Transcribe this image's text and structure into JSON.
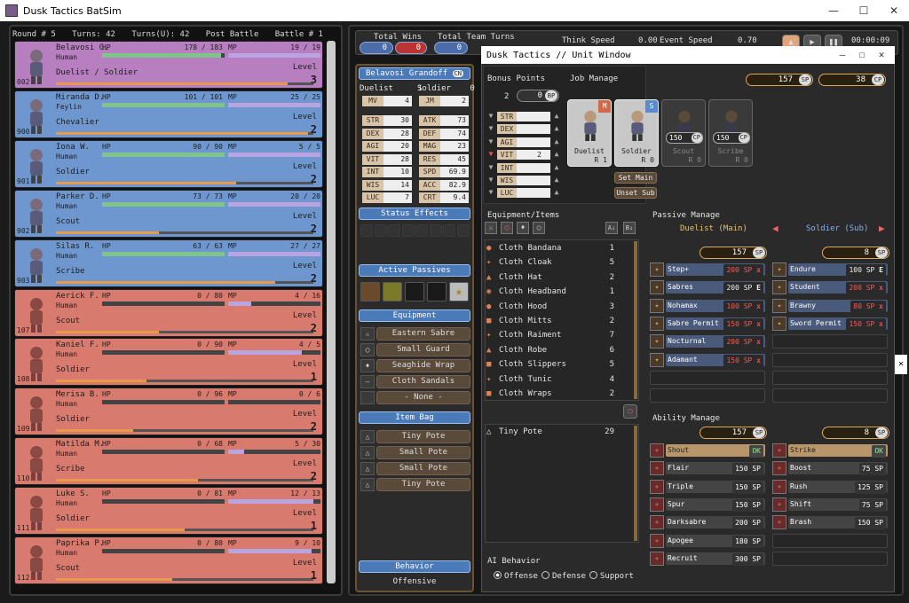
{
  "app": {
    "title": "Dusk Tactics BatSim"
  },
  "header": {
    "round": "Round # 5",
    "turns": "Turns: 42",
    "turnsu": "Turns(U): 42",
    "phase": "Post Battle",
    "battle": "Battle # 1"
  },
  "units": [
    {
      "id": "002",
      "name": "Belavosi G.",
      "race": "Human",
      "job": "Duelist / Soldier",
      "hp": "178 / 183",
      "mp": "19 / 19",
      "level": "3",
      "color": "#b77fc0",
      "hp_frac": 0.97,
      "mp_frac": 1.0,
      "xp_frac": 0.9
    },
    {
      "id": "900",
      "name": "Miranda D.",
      "race": "Feylin",
      "job": "Chevalier",
      "hp": "101 / 101",
      "mp": "25 / 25",
      "level": "2",
      "color": "#6f97cf",
      "hp_frac": 1.0,
      "mp_frac": 1.0,
      "xp_frac": 0.98
    },
    {
      "id": "901",
      "name": "Iona W.",
      "race": "Human",
      "job": "Soldier",
      "hp": "90 / 90",
      "mp": "5 / 5",
      "level": "2",
      "color": "#6f97cf",
      "hp_frac": 1.0,
      "mp_frac": 1.0,
      "xp_frac": 0.7
    },
    {
      "id": "902",
      "name": "Parker D.",
      "race": "Human",
      "job": "Scout",
      "hp": "73 / 73",
      "mp": "20 / 20",
      "level": "2",
      "color": "#6f97cf",
      "hp_frac": 1.0,
      "mp_frac": 1.0,
      "xp_frac": 0.4
    },
    {
      "id": "903",
      "name": "Silas R.",
      "race": "Human",
      "job": "Scribe",
      "hp": "63 / 63",
      "mp": "27 / 27",
      "level": "2",
      "color": "#6f97cf",
      "hp_frac": 1.0,
      "mp_frac": 1.0,
      "xp_frac": 0.85
    },
    {
      "id": "107",
      "name": "Aerick F.",
      "race": "Human",
      "job": "Scout",
      "hp": "0 / 80",
      "mp": "4 / 16",
      "level": "2",
      "color": "#d97a6e",
      "hp_frac": 0,
      "mp_frac": 0.25,
      "xp_frac": 0.4
    },
    {
      "id": "108",
      "name": "Kaniel F.",
      "race": "Human",
      "job": "Soldier",
      "hp": "0 / 90",
      "mp": "4 / 5",
      "level": "1",
      "color": "#d97a6e",
      "hp_frac": 0,
      "mp_frac": 0.8,
      "xp_frac": 0.35
    },
    {
      "id": "109",
      "name": "Merisa B.",
      "race": "Human",
      "job": "Soldier",
      "hp": "0 / 96",
      "mp": "0 / 6",
      "level": "2",
      "color": "#d97a6e",
      "hp_frac": 0,
      "mp_frac": 0,
      "xp_frac": 0.3
    },
    {
      "id": "110",
      "name": "Matilda M.",
      "race": "Human",
      "job": "Scribe",
      "hp": "0 / 68",
      "mp": "5 / 30",
      "level": "2",
      "color": "#d97a6e",
      "hp_frac": 0,
      "mp_frac": 0.17,
      "xp_frac": 0.55
    },
    {
      "id": "111",
      "name": "Luke S.",
      "race": "Human",
      "job": "Soldier",
      "hp": "0 / 81",
      "mp": "12 / 13",
      "level": "1",
      "color": "#d97a6e",
      "hp_frac": 0,
      "mp_frac": 0.92,
      "xp_frac": 0.5
    },
    {
      "id": "112",
      "name": "Paprika P.",
      "race": "Human",
      "job": "Scout",
      "hp": "0 / 80",
      "mp": "9 / 10",
      "level": "1",
      "color": "#d97a6e",
      "hp_frac": 0,
      "mp_frac": 0.9,
      "xp_frac": 0.45
    }
  ],
  "labels": {
    "hp": "HP",
    "mp": "MP",
    "level": "Level"
  },
  "topbar": {
    "total_wins": "Total Wins",
    "wins_a": "0",
    "wins_b": "0",
    "total_team_turns": "Total Team Turns",
    "tt_a": "0",
    "tt_b": "0",
    "think_speed": "Think Speed",
    "think_val": "0.00",
    "event_speed": "Event Speed",
    "event_val": "0.70",
    "timer": "00:00:09"
  },
  "side": {
    "name": "Belavosi Grandoff",
    "badge": "CN",
    "main_job": "Duelist",
    "main_lv": "1",
    "sub_job": "Soldier",
    "sub_lv": "0",
    "mv": "4",
    "jm": "2",
    "stats_left": [
      {
        "k": "STR",
        "v": "30"
      },
      {
        "k": "DEX",
        "v": "28"
      },
      {
        "k": "AGI",
        "v": "20"
      },
      {
        "k": "VIT",
        "v": "28"
      },
      {
        "k": "INT",
        "v": "10"
      },
      {
        "k": "WIS",
        "v": "14"
      },
      {
        "k": "LUC",
        "v": "7"
      }
    ],
    "stats_right": [
      {
        "k": "ATK",
        "v": "73"
      },
      {
        "k": "DEF",
        "v": "74"
      },
      {
        "k": "MAG",
        "v": "23"
      },
      {
        "k": "RES",
        "v": "45"
      },
      {
        "k": "SPD",
        "v": "69.9"
      },
      {
        "k": "ACC",
        "v": "82.9"
      },
      {
        "k": "CRT",
        "v": "9.4"
      }
    ],
    "mv_label": "MV",
    "jm_label": "JM",
    "status_effects": "Status Effects",
    "active_passives": "Active Passives",
    "equipment": "Equipment",
    "equip": [
      "Eastern Sabre",
      "Small Guard",
      "Seaghide Wrap",
      "Cloth Sandals",
      "- None -"
    ],
    "item_bag": "Item Bag",
    "items": [
      "Tiny Pote",
      "Small Pote",
      "Small Pote",
      "Tiny Pote"
    ],
    "behavior": "Behavior",
    "behavior_val": "Offensive"
  },
  "unitwin": {
    "title": "Dusk Tactics // Unit Window",
    "bonus_points": "Bonus Points",
    "bp_count": "2",
    "bp_val": "0",
    "bp_sym": "BP",
    "job_manage": "Job Manage",
    "sp_top": "157",
    "cp_top": "38",
    "sp_sym": "SP",
    "cp_sym": "CP",
    "bp_rows": [
      {
        "k": "STR",
        "v": ""
      },
      {
        "k": "DEX",
        "v": ""
      },
      {
        "k": "AGI",
        "v": ""
      },
      {
        "k": "VIT",
        "v": "2"
      },
      {
        "k": "INT",
        "v": ""
      },
      {
        "k": "WIS",
        "v": ""
      },
      {
        "k": "LUC",
        "v": ""
      }
    ],
    "jobs": [
      {
        "name": "Duelist",
        "rank": "R 1",
        "tag": "M"
      },
      {
        "name": "Soldier",
        "rank": "R 0",
        "tag": "S"
      },
      {
        "name": "Scout",
        "rank": "R 0",
        "cost": "150"
      },
      {
        "name": "Scribe",
        "rank": "R 0",
        "cost": "150"
      }
    ],
    "set_main": "Set Main",
    "unset_sub": "Unset Sub",
    "equip_items": "Equipment/Items",
    "inventory": [
      {
        "n": "Cloth Bandana",
        "q": "1"
      },
      {
        "n": "Cloth Cloak",
        "q": "5"
      },
      {
        "n": "Cloth Hat",
        "q": "2"
      },
      {
        "n": "Cloth Headband",
        "q": "1"
      },
      {
        "n": "Cloth Hood",
        "q": "3"
      },
      {
        "n": "Cloth Mitts",
        "q": "2"
      },
      {
        "n": "Cloth Raiment",
        "q": "7"
      },
      {
        "n": "Cloth Robe",
        "q": "6"
      },
      {
        "n": "Cloth Slippers",
        "q": "5"
      },
      {
        "n": "Cloth Tunic",
        "q": "4"
      },
      {
        "n": "Cloth Wraps",
        "q": "2"
      }
    ],
    "bag_items": [
      {
        "n": "Tiny Pote",
        "q": "29"
      }
    ],
    "passive_manage": "Passive Manage",
    "main_hdr": "Duelist (Main)",
    "sub_hdr": "Soldier (Sub)",
    "main_sp": "157",
    "sub_sp": "8",
    "passives_main": [
      {
        "n": "Step+",
        "c": "200 SP",
        "m": "x",
        "red": true
      },
      {
        "n": "Sabres",
        "c": "200 SP",
        "m": "E",
        "red": false
      },
      {
        "n": "Nohamax",
        "c": "100 SP",
        "m": "x",
        "red": true
      },
      {
        "n": "Sabre Permit",
        "c": "150 SP",
        "m": "x",
        "red": true
      },
      {
        "n": "Nocturnal",
        "c": "200 SP",
        "m": "x",
        "red": true
      },
      {
        "n": "Adamant",
        "c": "150 SP",
        "m": "x",
        "red": true
      }
    ],
    "passives_sub": [
      {
        "n": "Endure",
        "c": "100 SP",
        "m": "E",
        "red": false
      },
      {
        "n": "Student",
        "c": "200 SP",
        "m": "x",
        "red": true
      },
      {
        "n": "Brawny",
        "c": "80 SP",
        "m": "x",
        "red": true
      },
      {
        "n": "Sword Permit",
        "c": "150 SP",
        "m": "x",
        "red": true
      }
    ],
    "ability_manage": "Ability Manage",
    "ab_main_sp": "157",
    "ab_sub_sp": "8",
    "abilities_main": [
      {
        "n": "Shout",
        "c": "OK",
        "hi": true
      },
      {
        "n": "Flair",
        "c": "150 SP"
      },
      {
        "n": "Triple",
        "c": "150 SP"
      },
      {
        "n": "Spur",
        "c": "150 SP"
      },
      {
        "n": "Darksabre",
        "c": "200 SP"
      },
      {
        "n": "Apogee",
        "c": "180 SP"
      },
      {
        "n": "Recruit",
        "c": "300 SP"
      }
    ],
    "abilities_sub": [
      {
        "n": "Strike",
        "c": "OK",
        "hi": true
      },
      {
        "n": "Boost",
        "c": "75 SP"
      },
      {
        "n": "Rush",
        "c": "125 SP"
      },
      {
        "n": "Shift",
        "c": "75 SP"
      },
      {
        "n": "Brash",
        "c": "150 SP"
      }
    ],
    "ai_behavior": "AI Behavior",
    "offense": "Offense",
    "defense": "Defense",
    "support": "Support"
  },
  "colors": {
    "ally": "#6f97cf",
    "selected": "#b77fc0",
    "enemy": "#d97a6e",
    "hp": "#7fc48a",
    "mp": "#b9a3e0",
    "xp": "#e89a4a"
  },
  "icons": {
    "pause": "pause-icon",
    "play": "play-icon",
    "home": "home-icon"
  }
}
